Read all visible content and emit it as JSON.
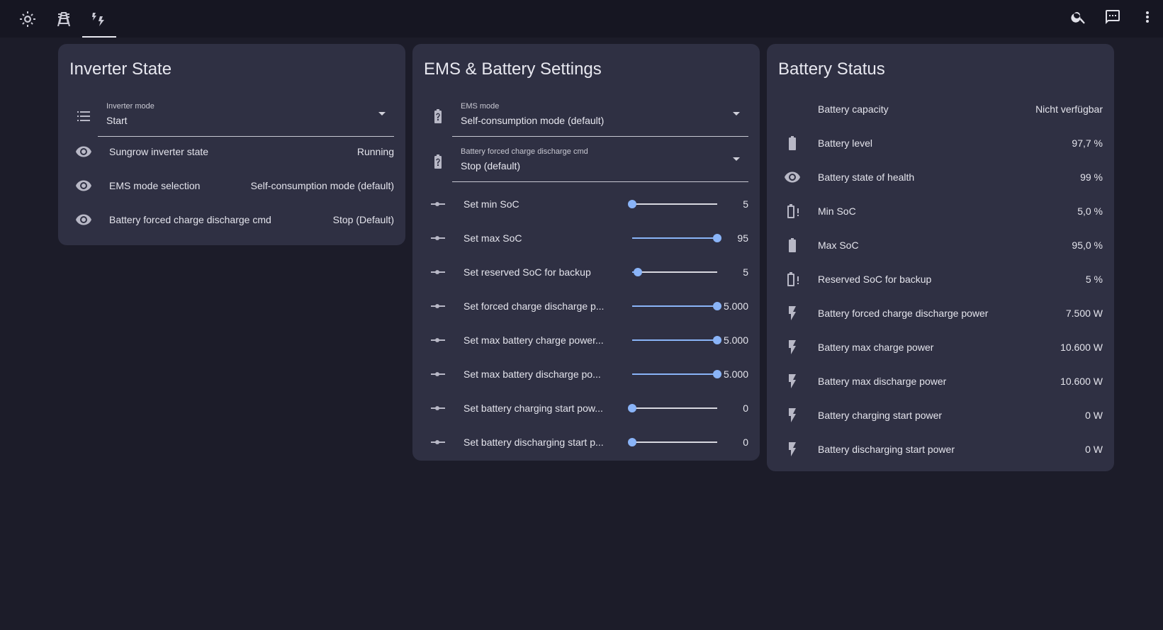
{
  "topbar": {
    "tabs": [
      {
        "icon": "solar-power-icon"
      },
      {
        "icon": "transmission-tower-icon"
      },
      {
        "icon": "weather-lightning-icon",
        "active": true
      }
    ],
    "actions": [
      "search-icon",
      "assist-icon",
      "more-vert-icon"
    ]
  },
  "inverter_state": {
    "title": "Inverter State",
    "mode_select": {
      "label": "Inverter mode",
      "value": "Start"
    },
    "rows": [
      {
        "label": "Sungrow inverter state",
        "value": "Running"
      },
      {
        "label": "EMS mode selection",
        "value": "Self-consumption mode (default)"
      },
      {
        "label": "Battery forced charge discharge cmd",
        "value": "Stop (Default)"
      }
    ]
  },
  "ems_settings": {
    "title": "EMS & Battery Settings",
    "selects": [
      {
        "label": "EMS mode",
        "value": "Self-consumption mode (default)"
      },
      {
        "label": "Battery forced charge discharge cmd",
        "value": "Stop (default)"
      }
    ],
    "sliders": [
      {
        "label": "Set min SoC",
        "value": "5",
        "level": 0.0
      },
      {
        "label": "Set max SoC",
        "value": "95",
        "level": 1.0
      },
      {
        "label": "Set reserved SoC for backup",
        "value": "5",
        "level": 0.07
      },
      {
        "label": "Set forced charge discharge p...",
        "value": "5.000",
        "level": 1.0
      },
      {
        "label": "Set max battery charge power...",
        "value": "5.000",
        "level": 1.0
      },
      {
        "label": "Set max battery discharge po...",
        "value": "5.000",
        "level": 1.0
      },
      {
        "label": "Set battery charging start pow...",
        "value": "0",
        "level": 0.0
      },
      {
        "label": "Set battery discharging start p...",
        "value": "0",
        "level": 0.0
      }
    ]
  },
  "battery_status": {
    "title": "Battery Status",
    "rows": [
      {
        "label": "Battery capacity",
        "value": "Nicht verfügbar",
        "icon": ""
      },
      {
        "label": "Battery level",
        "value": "97,7 %",
        "icon": "battery-icon"
      },
      {
        "label": "Battery state of health",
        "value": "99 %",
        "icon": "eye-icon"
      },
      {
        "label": "Min SoC",
        "value": "5,0 %",
        "icon": "battery-alert-icon"
      },
      {
        "label": "Max SoC",
        "value": "95,0 %",
        "icon": "battery-icon"
      },
      {
        "label": "Reserved SoC for backup",
        "value": "5 %",
        "icon": "battery-alert-icon"
      },
      {
        "label": "Battery forced charge discharge power",
        "value": "7.500 W",
        "icon": "flash-icon"
      },
      {
        "label": "Battery max charge power",
        "value": "10.600 W",
        "icon": "flash-icon"
      },
      {
        "label": "Battery max discharge power",
        "value": "10.600 W",
        "icon": "flash-icon"
      },
      {
        "label": "Battery charging start power",
        "value": "0 W",
        "icon": "flash-icon"
      },
      {
        "label": "Battery discharging start power",
        "value": "0 W",
        "icon": "flash-icon"
      }
    ]
  }
}
